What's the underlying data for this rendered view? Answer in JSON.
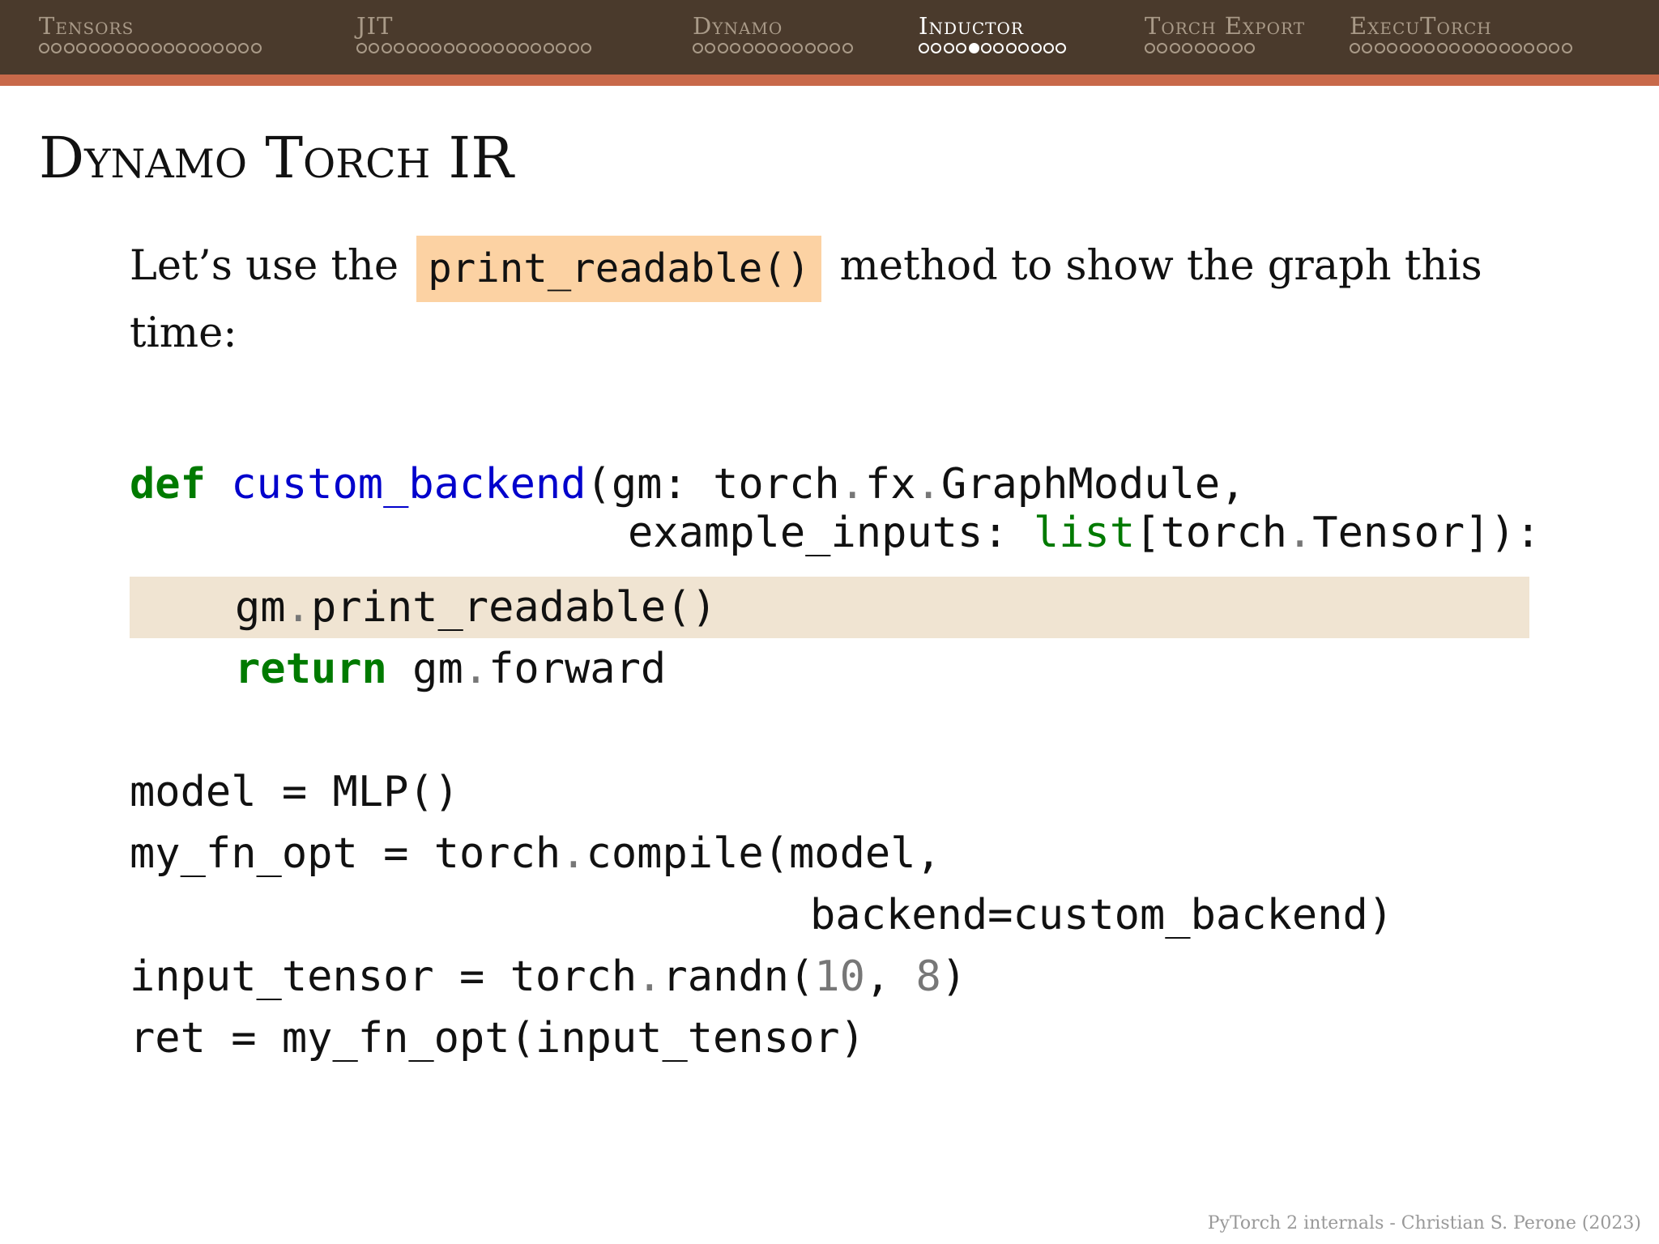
{
  "nav": {
    "sections": [
      {
        "label": "Tensors",
        "dots": 18,
        "filled": -1,
        "current": false
      },
      {
        "label": "JIT",
        "dots": 19,
        "filled": -1,
        "current": false
      },
      {
        "label": "Dynamo",
        "dots": 13,
        "filled": -1,
        "current": false
      },
      {
        "label": "Inductor",
        "dots": 12,
        "filled": 4,
        "current": true
      },
      {
        "label": "Torch Export",
        "dots": 9,
        "filled": -1,
        "current": false
      },
      {
        "label": "ExecuTorch",
        "dots": 18,
        "filled": -1,
        "current": false
      }
    ]
  },
  "slide": {
    "title": "Dynamo Torch IR",
    "intro_before": "Let’s use the",
    "intro_code": "print_readable()",
    "intro_after": "method to show the graph this time:"
  },
  "code": {
    "line1": {
      "kw": "def",
      "fn": "custom_backend",
      "rest_a": "(gm: torch",
      "dot1": ".",
      "rest_b": "fx",
      "dot2": ".",
      "rest_c": "GraphModule,"
    },
    "line2": {
      "a": "example_inputs: ",
      "bi": "list",
      "b": "[torch",
      "dot": ".",
      "c": "Tensor]):"
    },
    "line3": {
      "a": "gm",
      "dot": ".",
      "b": "print_readable()"
    },
    "line4": {
      "kw": "return",
      "a": " gm",
      "dot": ".",
      "b": "forward"
    },
    "line5": {
      "text": "model = MLP()"
    },
    "line6": {
      "a": "my_fn_opt = torch",
      "dot": ".",
      "b": "compile(model,"
    },
    "line7": {
      "text": "backend=custom_backend)"
    },
    "line8": {
      "a": "input_tensor = torch",
      "dot": ".",
      "b": "randn(",
      "n1": "10",
      "c": ", ",
      "n2": "8",
      "d": ")"
    },
    "line9": {
      "text": "ret = my_fn_opt(input_tensor)"
    }
  },
  "footer": "PyTorch 2 internals - Christian S. Perone (2023)"
}
